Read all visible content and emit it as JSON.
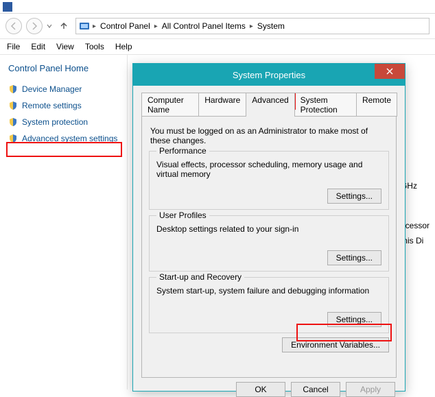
{
  "breadcrumb": {
    "items": [
      "Control Panel",
      "All Control Panel Items",
      "System"
    ]
  },
  "menu": {
    "file": "File",
    "edit": "Edit",
    "view": "View",
    "tools": "Tools",
    "help": "Help"
  },
  "sidebar": {
    "title": "Control Panel Home",
    "device_manager": "Device Manager",
    "remote_settings": "Remote settings",
    "system_protection": "System protection",
    "advanced_system_settings": "Advanced system settings"
  },
  "overflow": {
    "ghz": "GHz",
    "processor": "ocessor",
    "this_display": "this Di"
  },
  "dialog": {
    "title": "System Properties",
    "tabs": {
      "computer_name": "Computer Name",
      "hardware": "Hardware",
      "advanced": "Advanced",
      "system_protection": "System Protection",
      "remote": "Remote"
    },
    "admin_note": "You must be logged on as an Administrator to make most of these changes.",
    "performance": {
      "legend": "Performance",
      "desc": "Visual effects, processor scheduling, memory usage and virtual memory",
      "button": "Settings..."
    },
    "user_profiles": {
      "legend": "User Profiles",
      "desc": "Desktop settings related to your sign-in",
      "button": "Settings..."
    },
    "startup": {
      "legend": "Start-up and Recovery",
      "desc": "System start-up, system failure and debugging information",
      "button": "Settings..."
    },
    "env_button": "Environment Variables...",
    "ok": "OK",
    "cancel": "Cancel",
    "apply": "Apply"
  }
}
